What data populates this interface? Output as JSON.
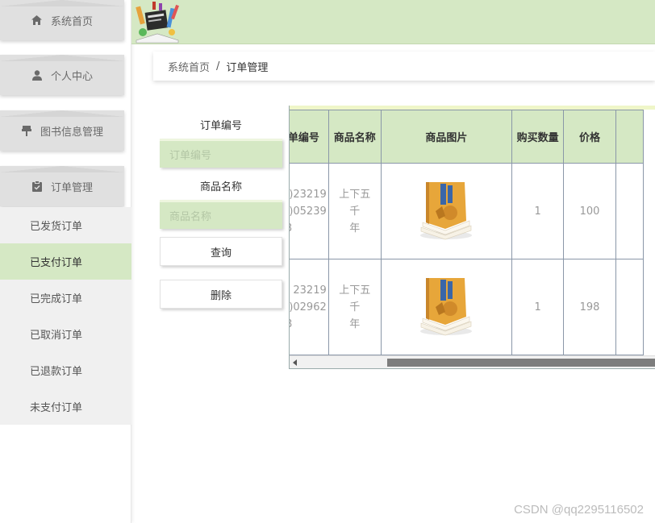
{
  "sidebar": {
    "tiles": [
      {
        "label": "系统首页",
        "icon": "home-icon"
      },
      {
        "label": "个人中心",
        "icon": "user-icon"
      },
      {
        "label": "图书信息管理",
        "icon": "pin-icon"
      },
      {
        "label": "订单管理",
        "icon": "clipboard-icon"
      }
    ],
    "submenu": [
      {
        "label": "已发货订单"
      },
      {
        "label": "已支付订单",
        "active": true
      },
      {
        "label": "已完成订单"
      },
      {
        "label": "已取消订单"
      },
      {
        "label": "已退款订单"
      },
      {
        "label": "未支付订单"
      }
    ]
  },
  "breadcrumb": {
    "home": "系统首页",
    "separator": "/",
    "current": "订单管理"
  },
  "search": {
    "order_no_label": "订单编号",
    "order_no_placeholder": "订单编号",
    "product_name_label": "商品名称",
    "product_name_placeholder": "商品名称",
    "query_button": "查询",
    "delete_button": "删除"
  },
  "table": {
    "headers": [
      "单编号",
      "商品名称",
      "商品图片",
      "购买数量",
      "价格"
    ],
    "rows": [
      {
        "id_lines": [
          ")23219",
          ")05239",
          "3"
        ],
        "name_lines": [
          "上下五千",
          "年"
        ],
        "qty": "1",
        "price": "100"
      },
      {
        "id_lines": [
          "23219",
          ")02962",
          "8"
        ],
        "name_lines": [
          "上下五千",
          "年"
        ],
        "qty": "1",
        "price": "198"
      }
    ]
  },
  "colors": {
    "accent": "#d5e8c4",
    "sidebar_tile": "#e0e0e0",
    "submenu_bg": "#f0f0f0"
  },
  "watermark": "CSDN @qq2295116502"
}
